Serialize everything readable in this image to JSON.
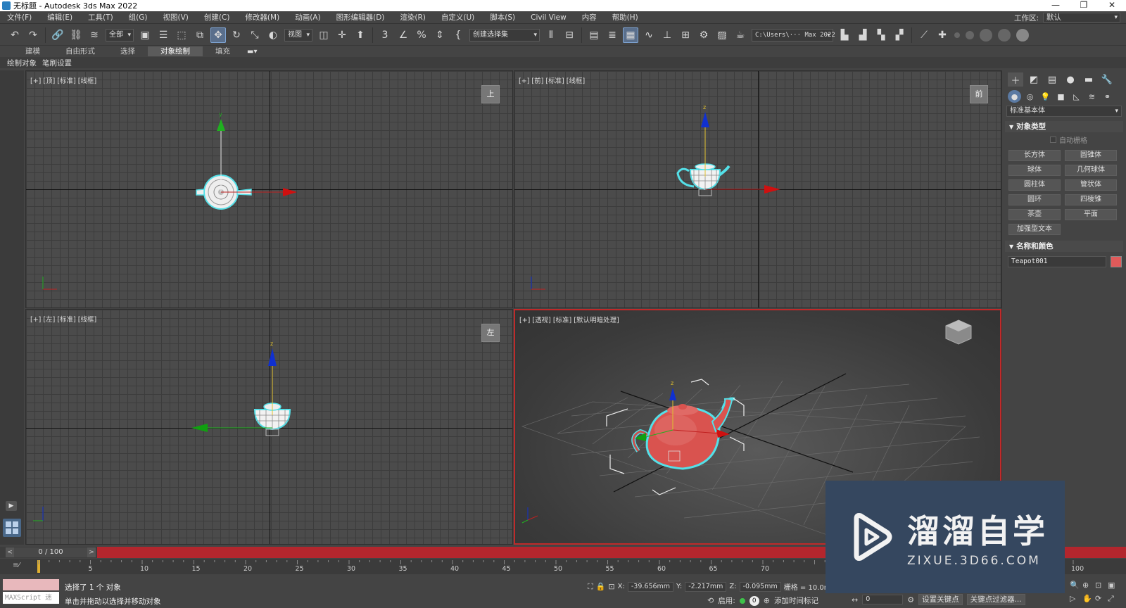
{
  "window": {
    "title": "无标题 - Autodesk 3ds Max 2022",
    "controls": [
      "—",
      "❐",
      "✕"
    ]
  },
  "menu": [
    "文件(F)",
    "编辑(E)",
    "工具(T)",
    "组(G)",
    "视图(V)",
    "创建(C)",
    "修改器(M)",
    "动画(A)",
    "图形编辑器(D)",
    "渲染(R)",
    "自定义(U)",
    "脚本(S)",
    "Civil View",
    "内容",
    "帮助(H)"
  ],
  "workspace": {
    "label": "工作区:",
    "value": "默认"
  },
  "toolbar": {
    "selection_filter": "全部",
    "ref_coord": "视图",
    "named_selection": "创建选择集",
    "project_path": "C:\\Users\\··· Max 2022"
  },
  "ribbon": {
    "tabs": [
      "建模",
      "自由形式",
      "选择",
      "对象绘制",
      "填充"
    ],
    "active_tab": "对象绘制",
    "subtabs": [
      "绘制对象",
      "笔刷设置"
    ]
  },
  "viewports": {
    "top": {
      "label": "[+] [顶] [标准] [线框]",
      "cube": "上",
      "gizmo_y": "y"
    },
    "front": {
      "label": "[+] [前] [标准] [线框]",
      "cube": "前",
      "gizmo_z": "z"
    },
    "left": {
      "label": "[+] [左] [标准] [线框]",
      "cube": "左",
      "gizmo_z": "z"
    },
    "persp": {
      "label": "[+] [透视] [标准] [默认明暗处理]",
      "gizmo_z": "z"
    }
  },
  "command_panel": {
    "category_select": "标准基本体",
    "object_type_title": "对象类型",
    "autogrid": "自动栅格",
    "buttons": [
      "长方体",
      "圆锥体",
      "球体",
      "几何球体",
      "圆柱体",
      "管状体",
      "圆环",
      "四棱锥",
      "茶壶",
      "平面",
      "加强型文本"
    ],
    "name_color_title": "名称和颜色",
    "object_name": "Teapot001",
    "object_color": "#e05a5a"
  },
  "timeline": {
    "frame_display": "0 / 100",
    "prev": "<",
    "next": ">",
    "ticks": [
      {
        "v": 5,
        "l": "5"
      },
      {
        "v": 10,
        "l": "10"
      },
      {
        "v": 15,
        "l": "15"
      },
      {
        "v": 20,
        "l": "20"
      },
      {
        "v": 25,
        "l": "25"
      },
      {
        "v": 30,
        "l": "30"
      },
      {
        "v": 35,
        "l": "35"
      },
      {
        "v": 40,
        "l": "40"
      },
      {
        "v": 45,
        "l": "45"
      },
      {
        "v": 50,
        "l": "50"
      },
      {
        "v": 55,
        "l": "55"
      },
      {
        "v": 60,
        "l": "60"
      },
      {
        "v": 65,
        "l": "65"
      },
      {
        "v": 70,
        "l": "70"
      },
      {
        "v": 100,
        "l": "100"
      }
    ]
  },
  "status": {
    "maxscript": "MAXScript 迷",
    "selected": "选择了 1 个 对象",
    "hint": "单击并拖动以选择并移动对象",
    "x_label": "X:",
    "x": "-39.656mm",
    "y_label": "Y:",
    "y": "-2.217mm",
    "z_label": "Z:",
    "z": "-0.095mm",
    "grid": "栅格 = 10.0m",
    "enable": "启用:",
    "add_time_tag": "添加时间标记",
    "frame": "0",
    "set_key": "设置关键点",
    "key_filters": "关键点过滤器..."
  },
  "watermark": {
    "brand": "溜溜自学",
    "url": "ZIXUE.3D66.COM"
  },
  "colors": {
    "timeslider": "#b3262d",
    "teapot": "#d9534f",
    "selection_outline": "#54e0e8",
    "accent": "#5a6f8c"
  }
}
